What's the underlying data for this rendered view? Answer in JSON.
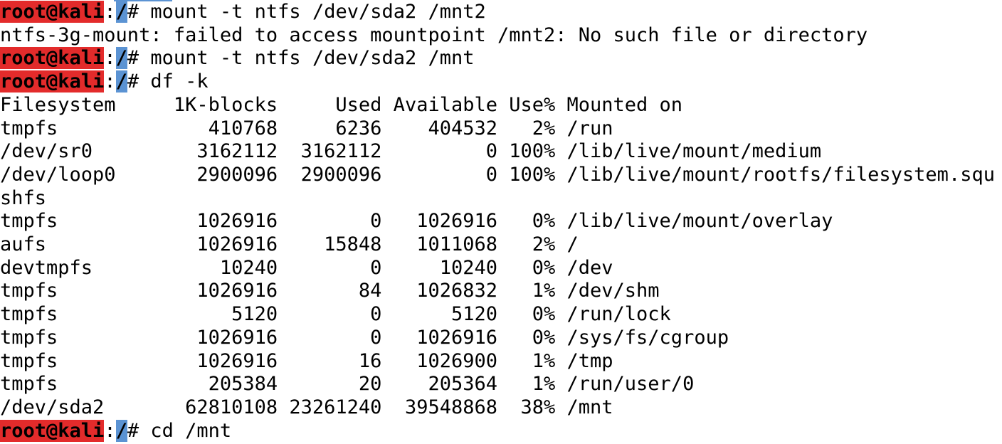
{
  "prompt": {
    "user_host": "root@kali",
    "separator": ":",
    "path": "/",
    "symbol": "#"
  },
  "commands": [
    " mount -t ntfs /dev/sda2 /mnt2",
    " mount -t ntfs /dev/sda2 /mnt",
    " df -k",
    " cd /mnt"
  ],
  "error_message": "ntfs-3g-mount: failed to access mountpoint /mnt2: No such file or directory",
  "df_output": {
    "header": "Filesystem     1K-blocks     Used Available Use% Mounted on",
    "rows": [
      "tmpfs             410768     6236    404532   2% /run",
      "/dev/sr0         3162112  3162112         0 100% /lib/live/mount/medium",
      "/dev/loop0       2900096  2900096         0 100% /lib/live/mount/rootfs/filesystem.squ",
      "shfs",
      "tmpfs            1026916        0   1026916   0% /lib/live/mount/overlay",
      "aufs             1026916    15848   1011068   2% /",
      "devtmpfs           10240        0     10240   0% /dev",
      "tmpfs            1026916       84   1026832   1% /dev/shm",
      "tmpfs               5120        0      5120   0% /run/lock",
      "tmpfs            1026916        0   1026916   0% /sys/fs/cgroup",
      "tmpfs            1026916       16   1026900   1% /tmp",
      "tmpfs             205384       20    205364   1% /run/user/0",
      "/dev/sda2       62810108 23261240  39548868  38% /mnt"
    ]
  },
  "colors": {
    "prompt_user_bg": "#e32b2b",
    "prompt_path_bg": "#5b93d3",
    "background": "#ffffff",
    "text": "#000000"
  }
}
